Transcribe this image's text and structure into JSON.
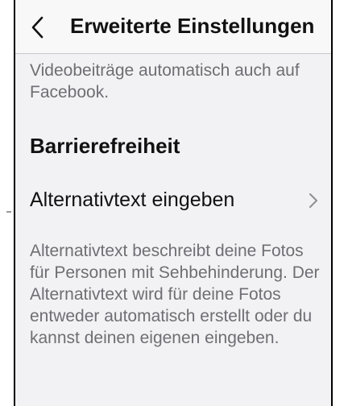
{
  "header": {
    "title": "Erweiterte Einstellungen",
    "back_icon": "chevron-left-icon"
  },
  "intro_text": "Videobeiträge automatisch auch auf Facebook.",
  "section": {
    "title": "Barrierefreiheit"
  },
  "row": {
    "label": "Alternativtext eingeben",
    "chevron_icon": "chevron-right-icon"
  },
  "description": "Alternativtext beschreibt deine Fotos für Personen mit Sehbehinderung. Der Alternativtext wird für deine Fotos entweder automatisch erstellt oder du kannst deinen eigenen eingeben.",
  "colors": {
    "background": "#f2f2f4",
    "header": "#f8f8f8",
    "primary_text": "#111111",
    "secondary_text": "#6e6e74"
  }
}
